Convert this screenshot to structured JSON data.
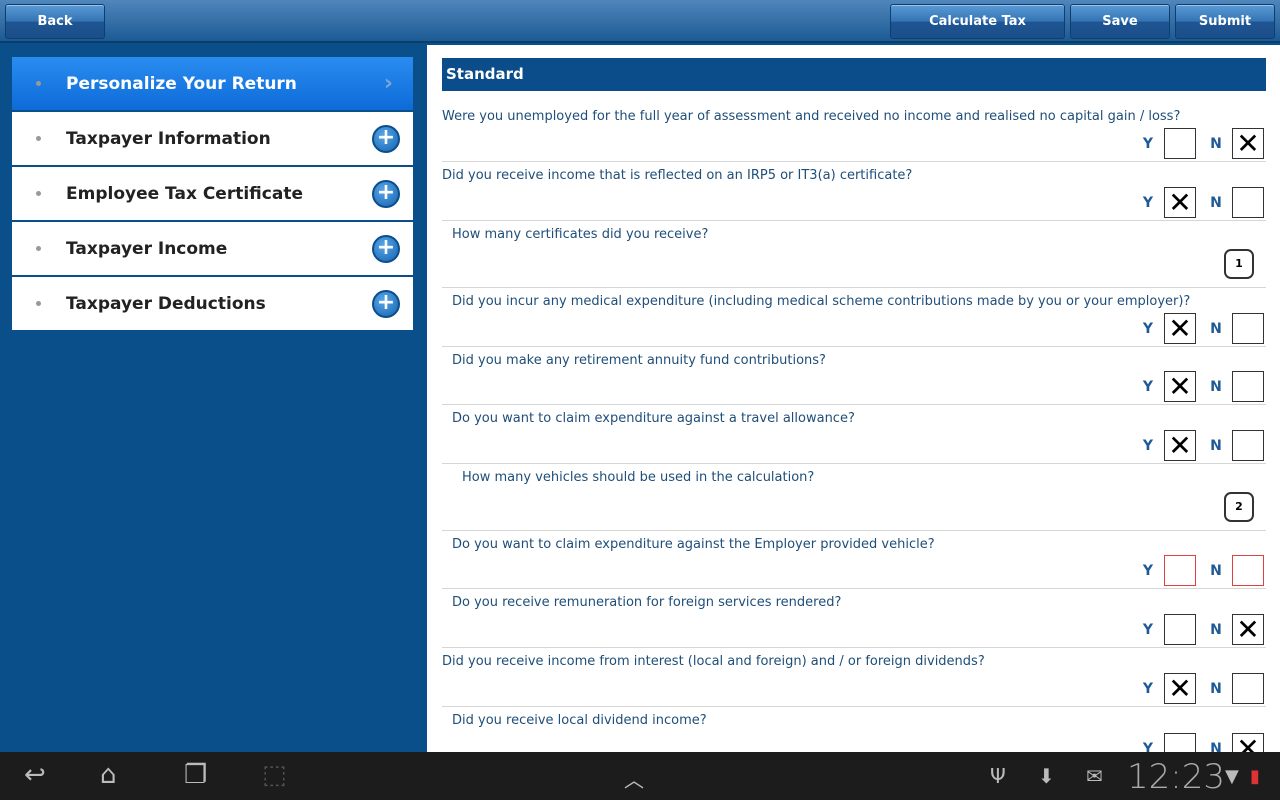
{
  "toolbar": {
    "back": "Back",
    "calculate": "Calculate Tax",
    "save": "Save",
    "submit": "Submit"
  },
  "sidebar": {
    "items": [
      {
        "label": "Personalize Your Return"
      },
      {
        "label": "Taxpayer Information"
      },
      {
        "label": "Employee Tax Certificate"
      },
      {
        "label": "Taxpayer Income"
      },
      {
        "label": "Taxpayer Deductions"
      }
    ]
  },
  "main": {
    "section": "Standard",
    "y": "Y",
    "n": "N",
    "x": "✕",
    "questions": [
      {
        "text": "Were you unemployed for the full year of assessment and received no income and realised no capital gain / loss?",
        "answer": "N"
      },
      {
        "text": "Did you receive income that is reflected on an IRP5 or IT3(a) certificate?",
        "answer": "Y"
      },
      {
        "text": "How many certificates did you receive?",
        "count": "1"
      },
      {
        "text": "Did you incur any medical expenditure (including medical scheme contributions made by you or your employer)?",
        "answer": "Y"
      },
      {
        "text": "Did you make any retirement annuity fund contributions?",
        "answer": "Y"
      },
      {
        "text": "Do you want to claim expenditure against a travel allowance?",
        "answer": "Y"
      },
      {
        "text": "How many vehicles should be used in the calculation?",
        "count": "2"
      },
      {
        "text": "Do you want to claim expenditure against the Employer provided vehicle?",
        "answer": "",
        "required": true
      },
      {
        "text": "Do you receive remuneration for foreign services rendered?",
        "answer": "N"
      },
      {
        "text": "Did you receive income from interest (local and foreign) and / or foreign dividends?",
        "answer": "Y"
      },
      {
        "text": "Did you receive local dividend income?",
        "answer": "N"
      }
    ]
  },
  "statusbar": {
    "time": "12:23"
  }
}
